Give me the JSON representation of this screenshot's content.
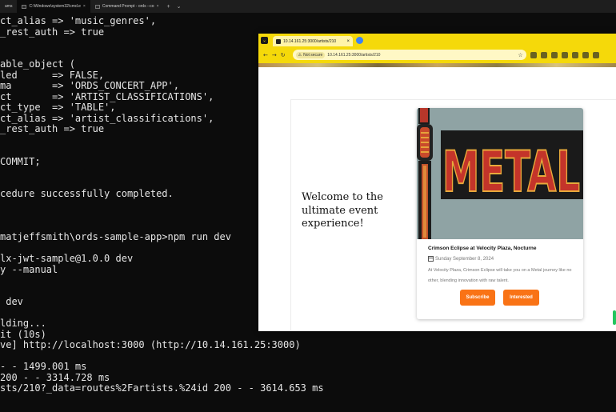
{
  "terminal": {
    "tabs": [
      {
        "label": "ams"
      },
      {
        "label": "C:\\Windows\\system32\\cmd.e"
      },
      {
        "label": "Command Prompt - ords --co"
      }
    ],
    "new_tab": "+",
    "dropdown": "⌄",
    "lines": [
      "ct_alias => 'music_genres',",
      "_rest_auth => true",
      "",
      "",
      "able_object (",
      "led      => FALSE,",
      "ma       => 'ORDS_CONCERT_APP',",
      "ct       => 'ARTIST_CLASSIFICATIONS',",
      "ct_type  => 'TABLE',",
      "ct_alias => 'artist_classifications',",
      "_rest_auth => true",
      "",
      "",
      "COMMIT;",
      "",
      "",
      "cedure successfully completed.",
      "",
      "",
      "",
      "matjeffsmith\\ords-sample-app>npm run dev",
      "",
      "lx-jwt-sample@1.0.0 dev",
      "y --manual",
      "",
      "",
      " dev",
      "",
      "lding...",
      "it (10s)",
      "ve] http://localhost:3000 (http://10.14.161.25:3000)",
      "",
      "- - 1499.001 ms",
      "200 - - 3314.728 ms",
      "sts/210?_data=routes%2Fartists.%24id 200 - - 3614.653 ms"
    ]
  },
  "browser": {
    "tab_title": "10.14.161.25:3000/artists/210",
    "tab_close": "×",
    "nav": {
      "back": "←",
      "forward": "→",
      "reload": "↻"
    },
    "not_secure": "Not secure",
    "url": "10.14.161.25:3000/artists/210",
    "star": "☆",
    "colors": {
      "chrome": "#f5d90a",
      "accent_button": "#f97316"
    }
  },
  "page": {
    "welcome": "Welcome to the ultimate event experience!",
    "poster_text": "METAL",
    "card": {
      "title": "Crimson Eclipse at Velocity Plaza, Nocturne",
      "date": "Sunday September 8, 2024",
      "description": "At Velocity Plaza, Crimson Eclipse will take you on a Metal journey like no other, blending innovation with raw talent.",
      "subscribe_label": "Subscribe",
      "interested_label": "Interested"
    }
  }
}
